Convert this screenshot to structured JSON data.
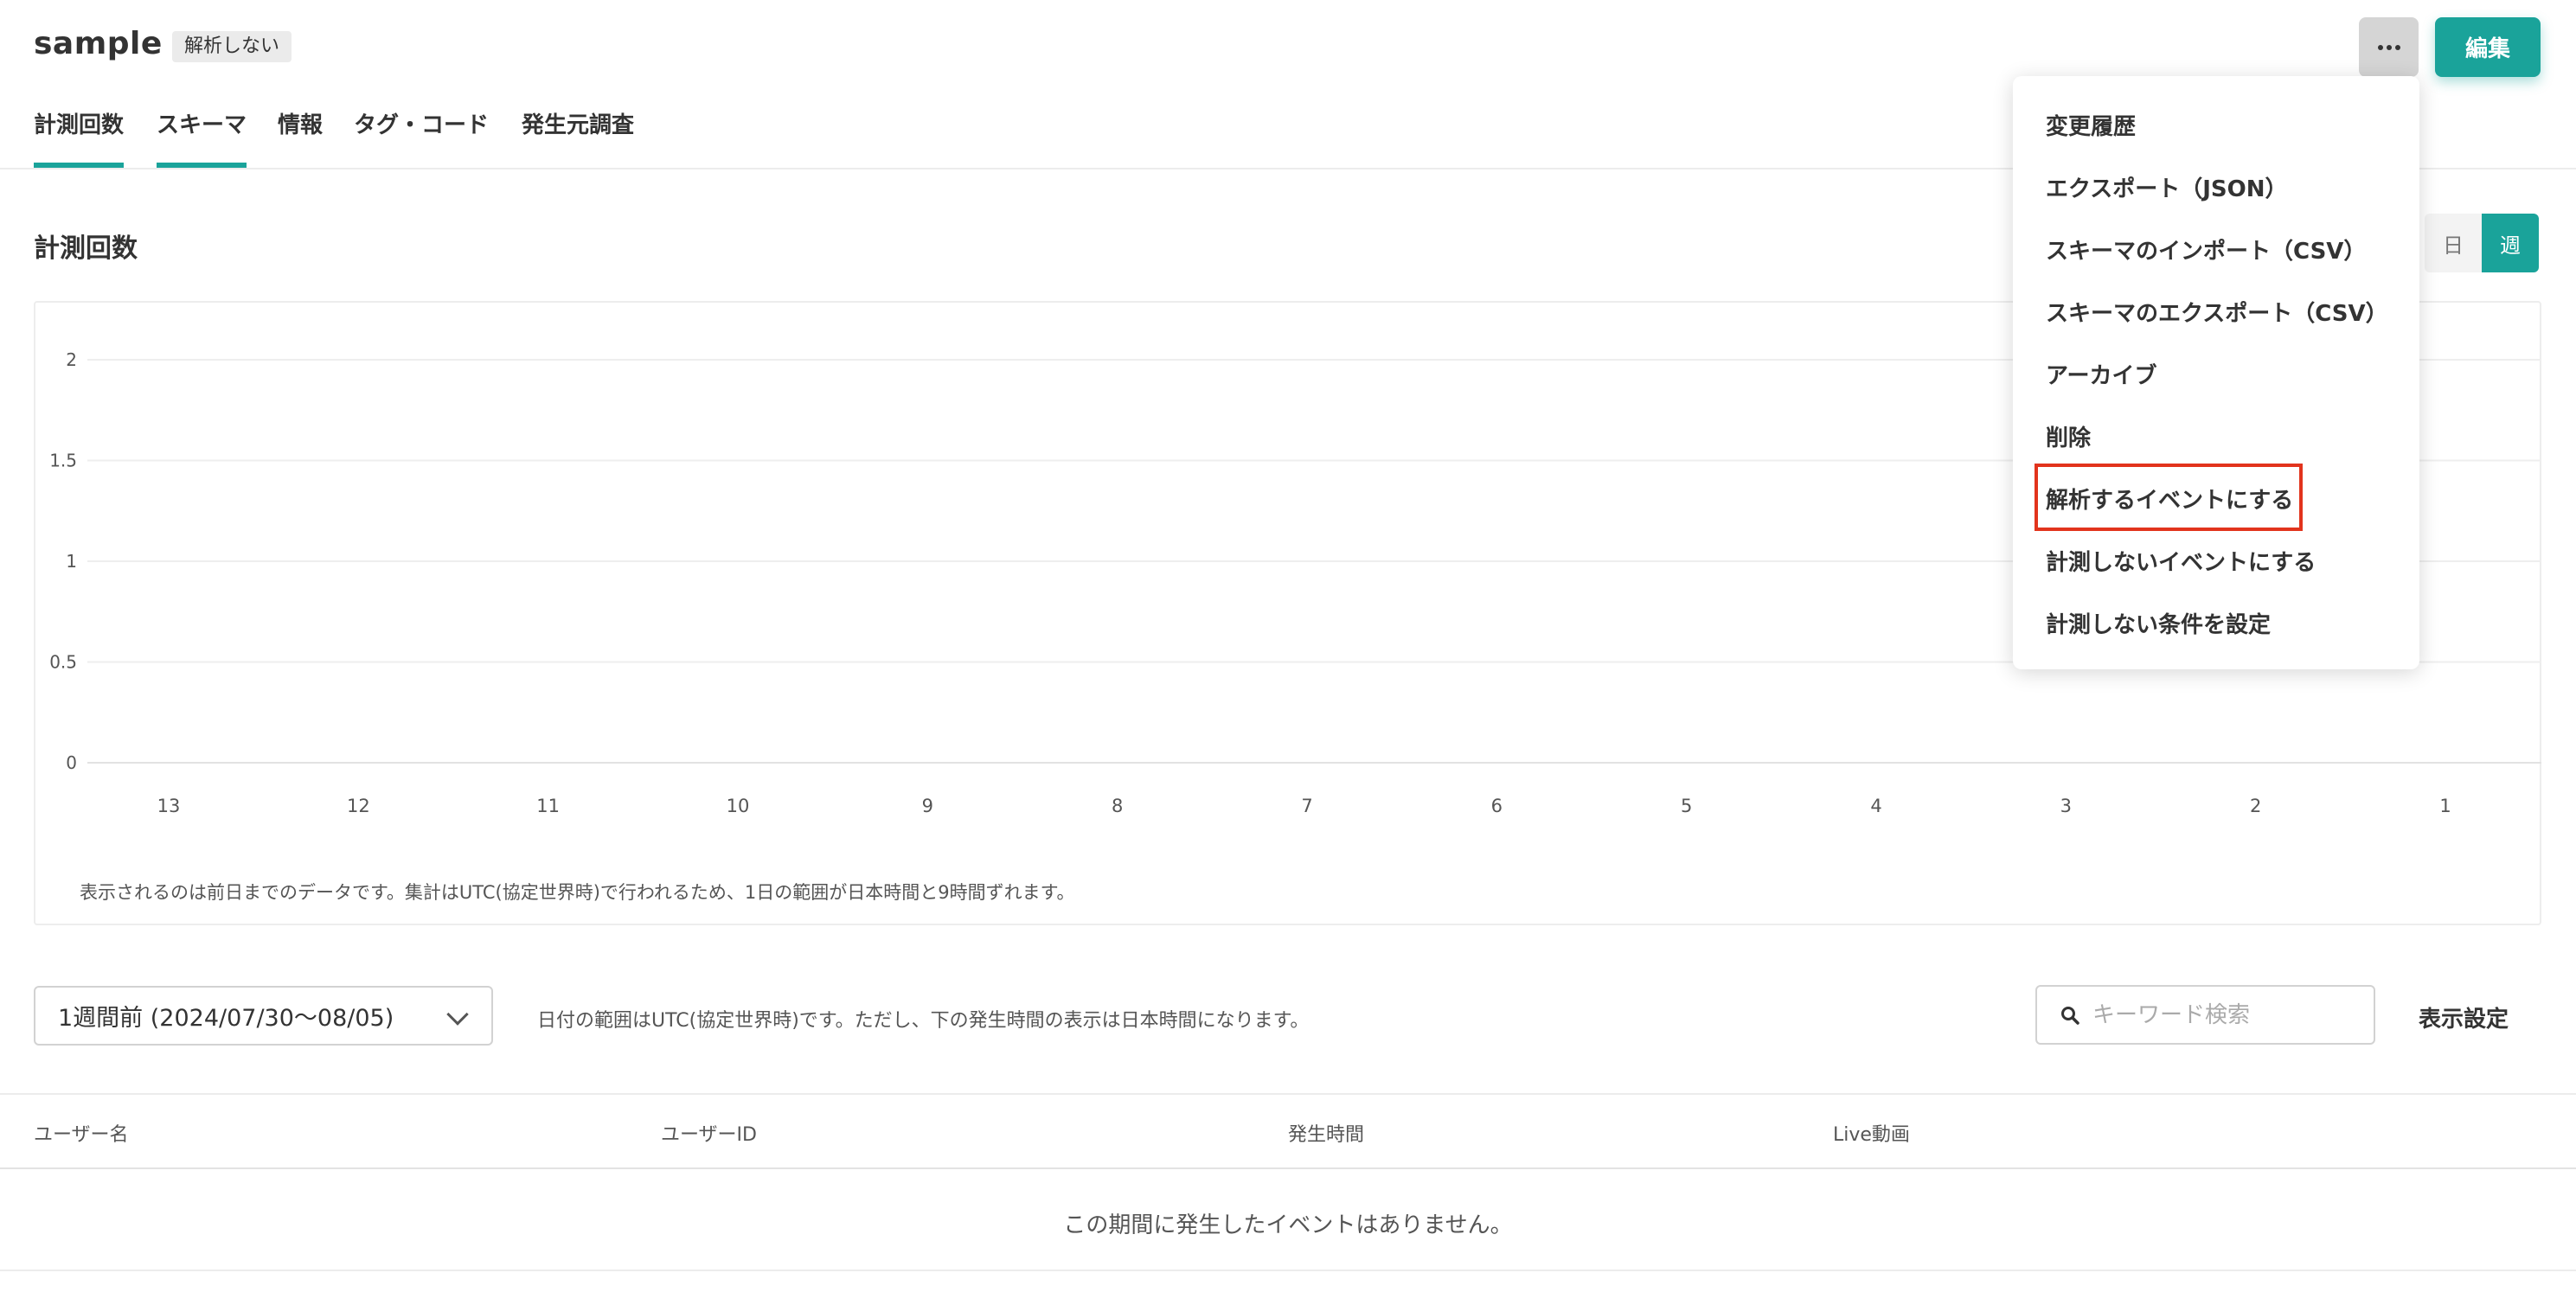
{
  "header": {
    "title": "sample",
    "status_badge": "解析しない",
    "edit_label": "編集"
  },
  "tabs": [
    {
      "label": "計測回数",
      "active": true
    },
    {
      "label": "スキーマ",
      "active": true
    },
    {
      "label": "情報",
      "active": false
    },
    {
      "label": "タグ・コード",
      "active": false
    },
    {
      "label": "発生元調査",
      "active": false
    }
  ],
  "section": {
    "title": "計測回数",
    "period_options": [
      "日",
      "週"
    ],
    "selected_period": "週"
  },
  "chart_data": {
    "type": "line",
    "x": [
      13,
      12,
      11,
      10,
      9,
      8,
      7,
      6,
      5,
      4,
      3,
      2,
      1
    ],
    "series": [
      {
        "values": [
          0,
          0,
          0,
          0,
          0,
          0,
          0,
          0,
          0,
          0,
          0,
          0,
          0
        ]
      }
    ],
    "yticks": [
      "2",
      "1.5",
      "1",
      "0.5",
      "0"
    ],
    "ylim": [
      0,
      2
    ],
    "grid": true,
    "title": "",
    "xlabel": "",
    "ylabel": ""
  },
  "chart_note": "表示されるのは前日までのデータです。集計はUTC(協定世界時)で行われるため、1日の範囲が日本時間と9時間ずれます。",
  "filters": {
    "range_value": "1週間前 (2024/07/30〜08/05)",
    "range_note": "日付の範囲はUTC(協定世界時)です。ただし、下の発生時間の表示は日本時間になります。",
    "search_placeholder": "キーワード検索",
    "display_settings": "表示設定"
  },
  "table": {
    "columns": [
      "ユーザー名",
      "ユーザーID",
      "発生時間",
      "Live動画"
    ],
    "empty_message": "この期間に発生したイベントはありません。"
  },
  "menu": {
    "items": [
      "変更履歴",
      "エクスポート（JSON）",
      "スキーマのインポート（CSV）",
      "スキーマのエクスポート（CSV）",
      "アーカイブ",
      "削除",
      "解析するイベントにする",
      "計測しないイベントにする",
      "計測しない条件を設定"
    ],
    "highlighted_item": "解析するイベントにする"
  },
  "colors": {
    "accent": "#1aa39a",
    "highlight": "#e2341d",
    "grid": "#eeeeee"
  }
}
